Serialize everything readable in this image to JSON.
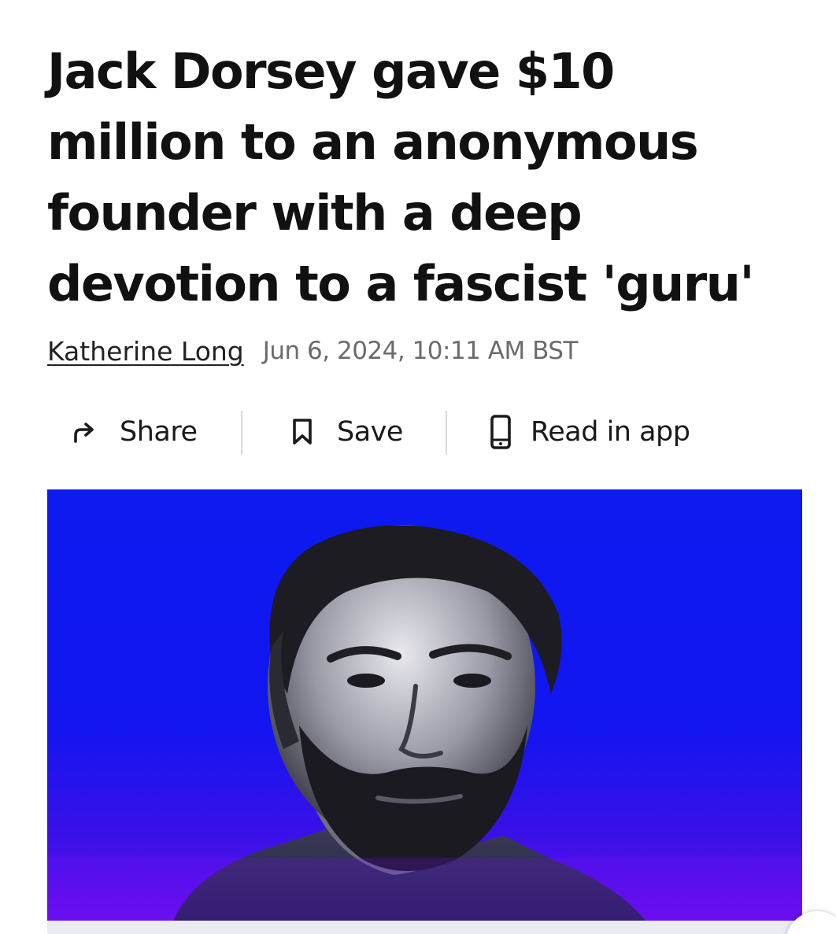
{
  "article": {
    "headline": "Jack Dorsey gave $10 million to an anonymous founder with a deep devotion to a fascist 'guru'",
    "author": "Katherine Long",
    "date": "Jun 6, 2024, 10:11 AM BST"
  },
  "actions": {
    "share_label": "Share",
    "save_label": "Save",
    "read_in_app_label": "Read in app",
    "share_icon": "share-arrow-icon",
    "save_icon": "bookmark-icon",
    "read_in_app_icon": "phone-icon"
  },
  "hero_image": {
    "subject": "portrait photo on blue background",
    "background_color": "#0d1af0",
    "accent_bottom_color": "#6a0ef0"
  },
  "colors": {
    "text": "#111111",
    "date": "#6b6b6b",
    "divider": "#d8d8d8"
  }
}
